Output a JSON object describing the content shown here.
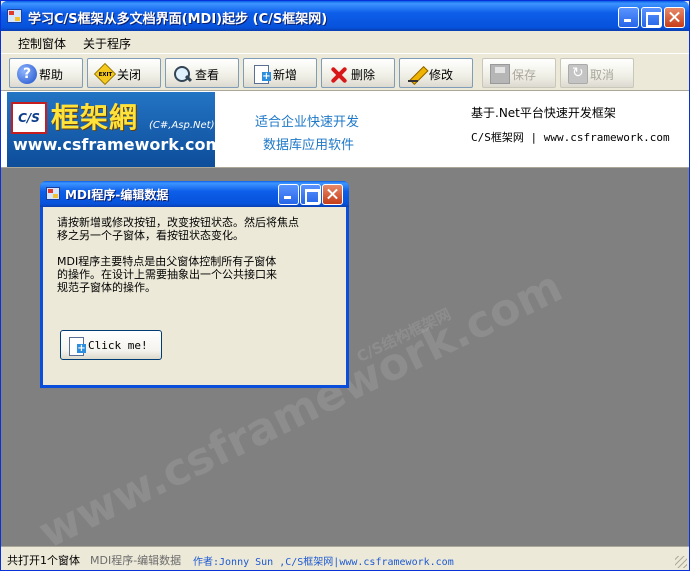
{
  "window": {
    "title": "学习C/S框架从多文档界面(MDI)起步 (C/S框架网)"
  },
  "menu": {
    "items": [
      "控制窗体",
      "关于程序"
    ]
  },
  "toolbar": {
    "buttons": [
      {
        "label": "帮助",
        "icon": "help-icon",
        "enabled": true
      },
      {
        "label": "关闭",
        "icon": "exit-sign-icon",
        "enabled": true
      },
      {
        "label": "查看",
        "icon": "search-icon",
        "enabled": true
      },
      {
        "label": "新增",
        "icon": "new-document-icon",
        "enabled": true
      },
      {
        "label": "删除",
        "icon": "delete-x-icon",
        "enabled": true
      },
      {
        "label": "修改",
        "icon": "pencil-icon",
        "enabled": true
      },
      {
        "label": "保存",
        "icon": "save-disk-icon",
        "enabled": false
      },
      {
        "label": "取消",
        "icon": "undo-icon",
        "enabled": false
      }
    ]
  },
  "banner": {
    "logo_cs": "C/S",
    "logo_big": "框架網",
    "logo_sub": "(C#,Asp.Net)",
    "logo_url": "www.csframework.com",
    "slogan_line1": "适合企业快速开发",
    "slogan_line2": "数据库应用软件",
    "right_line1": "基于.Net平台快速开发框架",
    "right_line2": "C/S框架网 | www.csframework.com"
  },
  "watermark": {
    "main": "www.csframework.com",
    "sub": "C/S结构框架网"
  },
  "child_window": {
    "title": "MDI程序-编辑数据",
    "text_lines": [
      "请按新增或修改按钮，改变按钮状态。然后将焦点",
      "移之另一个子窗体，看按钮状态变化。",
      "",
      "MDI程序主要特点是由父窗体控制所有子窗体",
      "的操作。在设计上需要抽象出一个公共接口来",
      "规范子窗体的操作。"
    ],
    "button_label": "Click me!"
  },
  "statusbar": {
    "count": "共打开1个窗体",
    "active": "MDI程序-编辑数据",
    "author": "作者:Jonny Sun ,C/S框架网|www.csframework.com"
  }
}
